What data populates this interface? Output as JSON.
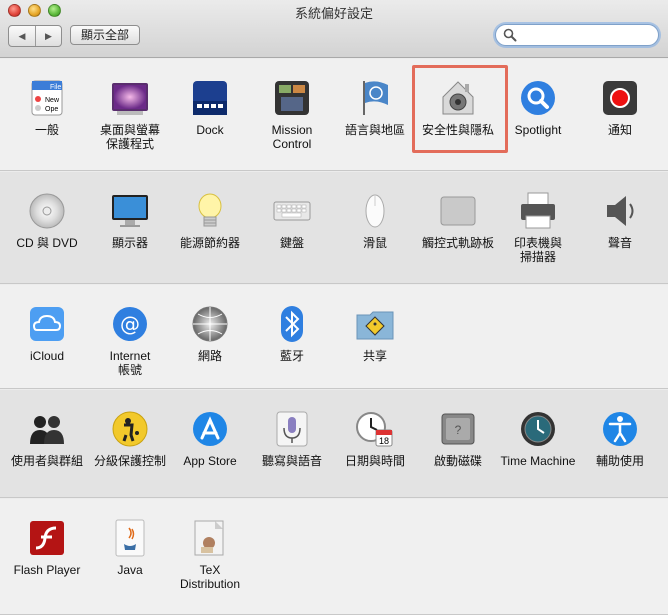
{
  "window": {
    "title": "系統偏好設定"
  },
  "toolbar": {
    "back": "◀",
    "forward": "▶",
    "show_all": "顯示全部",
    "search_placeholder": "",
    "search_value": ""
  },
  "colors": {
    "highlight": "#e36c5a"
  },
  "rows": [
    {
      "items": [
        {
          "label": "一般",
          "icon": "general-icon"
        },
        {
          "label": "桌面與螢幕\n保護程式",
          "icon": "desktop-screensaver-icon"
        },
        {
          "label": "Dock",
          "icon": "dock-icon"
        },
        {
          "label": "Mission\nControl",
          "icon": "mission-control-icon"
        },
        {
          "label": "語言與地區",
          "icon": "language-region-icon"
        },
        {
          "label": "安全性與隱私",
          "icon": "security-privacy-icon",
          "highlighted": true
        },
        {
          "label": "Spotlight",
          "icon": "spotlight-icon"
        },
        {
          "label": "通知",
          "icon": "notifications-icon"
        }
      ]
    },
    {
      "items": [
        {
          "label": "CD 與 DVD",
          "icon": "cd-dvd-icon"
        },
        {
          "label": "顯示器",
          "icon": "displays-icon"
        },
        {
          "label": "能源節約器",
          "icon": "energy-saver-icon"
        },
        {
          "label": "鍵盤",
          "icon": "keyboard-icon"
        },
        {
          "label": "滑鼠",
          "icon": "mouse-icon"
        },
        {
          "label": "觸控式軌跡板",
          "icon": "trackpad-icon"
        },
        {
          "label": "印表機與\n掃描器",
          "icon": "printers-scanners-icon"
        },
        {
          "label": "聲音",
          "icon": "sound-icon"
        }
      ]
    },
    {
      "items": [
        {
          "label": "iCloud",
          "icon": "icloud-icon"
        },
        {
          "label": "Internet\n帳號",
          "icon": "internet-accounts-icon"
        },
        {
          "label": "網路",
          "icon": "network-icon"
        },
        {
          "label": "藍牙",
          "icon": "bluetooth-icon"
        },
        {
          "label": "共享",
          "icon": "sharing-icon"
        }
      ]
    },
    {
      "items": [
        {
          "label": "使用者與群組",
          "icon": "users-groups-icon"
        },
        {
          "label": "分級保護控制",
          "icon": "parental-controls-icon"
        },
        {
          "label": "App Store",
          "icon": "app-store-icon"
        },
        {
          "label": "聽寫與語音",
          "icon": "dictation-speech-icon"
        },
        {
          "label": "日期與時間",
          "icon": "date-time-icon",
          "badge": "18"
        },
        {
          "label": "啟動磁碟",
          "icon": "startup-disk-icon"
        },
        {
          "label": "Time Machine",
          "icon": "time-machine-icon"
        },
        {
          "label": "輔助使用",
          "icon": "accessibility-icon"
        }
      ]
    },
    {
      "items": [
        {
          "label": "Flash Player",
          "icon": "flash-player-icon"
        },
        {
          "label": "Java",
          "icon": "java-icon"
        },
        {
          "label": "TeX\nDistribution",
          "icon": "tex-distribution-icon"
        }
      ]
    }
  ]
}
